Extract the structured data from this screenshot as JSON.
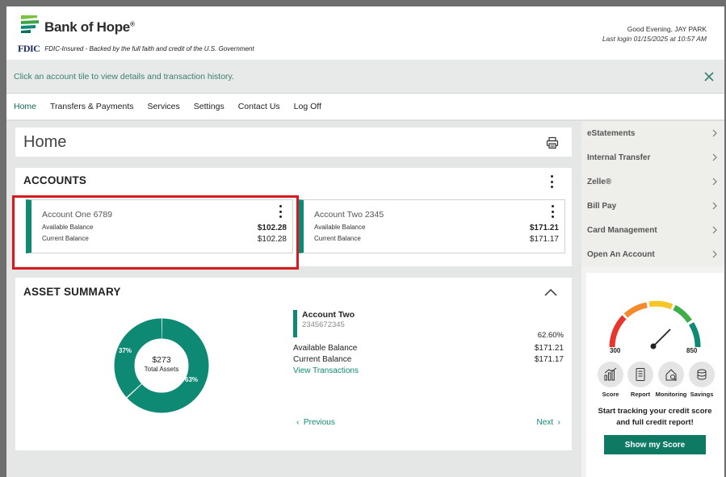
{
  "header": {
    "brand": "Bank of Hope",
    "brand_mark": "®",
    "fdic_logo": "FDIC",
    "fdic_text": "FDIC-Insured - Backed by the full faith and credit of the U.S. Government",
    "greeting": "Good Evening, JAY PARK",
    "last_login": "Last login 01/15/2025 at 10:57 AM"
  },
  "banner": {
    "text": "Click an account tile to view details and transaction history.",
    "close_icon": "close-icon"
  },
  "nav": {
    "items": [
      "Home",
      "Transfers & Payments",
      "Services",
      "Settings",
      "Contact Us",
      "Log Off"
    ],
    "active": "Home"
  },
  "home": {
    "title": "Home",
    "print_icon": "printer-icon"
  },
  "accounts": {
    "heading": "ACCOUNTS",
    "tiles": [
      {
        "name": "Account One 6789",
        "available_label": "Available Balance",
        "available": "$102.28",
        "current_label": "Current Balance",
        "current": "$102.28"
      },
      {
        "name": "Account Two 2345",
        "available_label": "Available Balance",
        "available": "$171.21",
        "current_label": "Current Balance",
        "current": "$171.17"
      }
    ]
  },
  "asset_summary": {
    "heading": "ASSET SUMMARY",
    "total": "$273",
    "total_label": "Total Assets",
    "slices": [
      {
        "label": "37%",
        "value": 37,
        "color": "#0e8a74"
      },
      {
        "label": "63%",
        "value": 63,
        "color": "#0e8a74"
      }
    ],
    "detail": {
      "name": "Account Two",
      "number": "2345672345",
      "percent": "62.60%",
      "available_label": "Available Balance",
      "available": "$171.21",
      "current_label": "Current Balance",
      "current": "$171.17",
      "link": "View Transactions"
    },
    "prev": "Previous",
    "next": "Next"
  },
  "side_menu": {
    "items": [
      "eStatements",
      "Internal Transfer",
      "Zelle®",
      "Bill Pay",
      "Card Management",
      "Open An Account"
    ]
  },
  "credit": {
    "min": "300",
    "max": "850",
    "icons": [
      {
        "label": "Score",
        "icon": "bar-chart-icon"
      },
      {
        "label": "Report",
        "icon": "document-icon"
      },
      {
        "label": "Monitoring",
        "icon": "monitoring-icon"
      },
      {
        "label": "Savings",
        "icon": "savings-icon"
      }
    ],
    "cta": "Start tracking your credit score and full credit report!",
    "button": "Show my Score"
  },
  "colors": {
    "accent": "#0e8a74",
    "button": "#0e7a63",
    "highlight": "#d71920"
  }
}
